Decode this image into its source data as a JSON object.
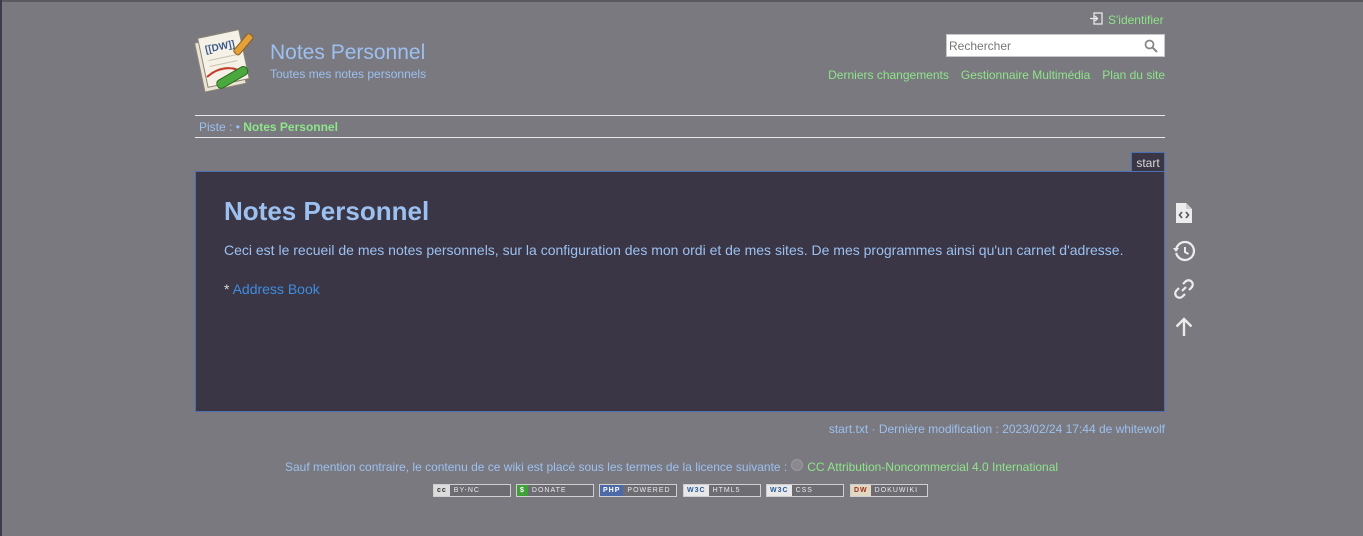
{
  "site": {
    "title": "Notes Personnel",
    "tagline": "Toutes mes notes personnels"
  },
  "user_tools": {
    "login_label": "S'identifier"
  },
  "search": {
    "placeholder": "Rechercher"
  },
  "site_tools": [
    {
      "label": "Derniers changements"
    },
    {
      "label": "Gestionnaire Multimédia"
    },
    {
      "label": "Plan du site"
    }
  ],
  "breadcrumb": {
    "label": "Piste :",
    "separator": "•",
    "current": "Notes Personnel"
  },
  "page": {
    "tab_label": "start",
    "heading": "Notes Personnel",
    "paragraph": "Ceci est le recueil de mes notes personnels, sur la configuration des mon ordi et de mes sites. De mes programmes ainsi qu'un carnet d'adresse.",
    "list_bullet": "*",
    "link_text": "Address Book"
  },
  "page_tools": [
    {
      "name": "show-source",
      "icon": "file-code-icon"
    },
    {
      "name": "old-revisions",
      "icon": "history-icon"
    },
    {
      "name": "backlinks",
      "icon": "link-icon"
    },
    {
      "name": "back-to-top",
      "icon": "arrow-up-icon"
    }
  ],
  "doc_info": "start.txt · Dernière modification : 2023/02/24 17:44 de whitewolf",
  "footer": {
    "license_text": "Sauf mention contraire, le contenu de ce wiki est placé sous les termes de la licence suivante :",
    "license_link": "CC Attribution-Noncommercial 4.0 International",
    "badges": [
      {
        "tag": "cc",
        "text": "BY-NC"
      },
      {
        "tag": "$",
        "text": "DONATE"
      },
      {
        "tag": "PHP",
        "text": "POWERED"
      },
      {
        "tag": "W3C",
        "text": "HTML5"
      },
      {
        "tag": "W3C",
        "text": "CSS"
      },
      {
        "tag": "DW",
        "text": "DOKUWIKI"
      }
    ]
  },
  "colors": {
    "background": "#7a797f",
    "content_bg": "#3a3645",
    "title_blue": "#9cc0f0",
    "link_green": "#8ee58a",
    "link_blue": "#3f8ce0"
  }
}
